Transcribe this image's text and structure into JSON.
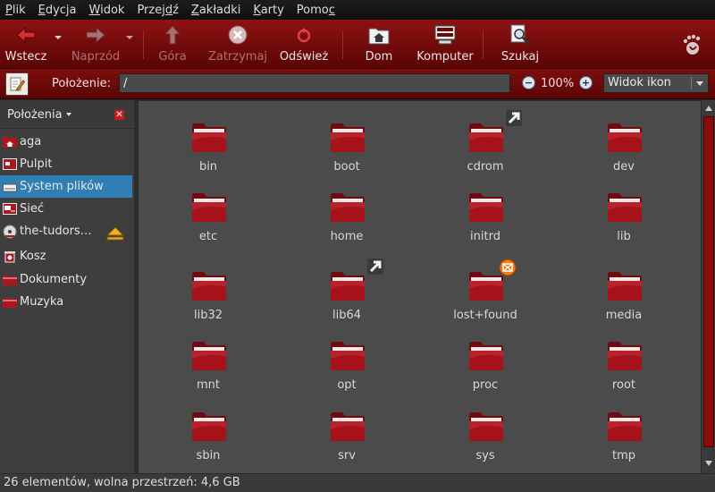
{
  "menubar": {
    "items": [
      {
        "first": "P",
        "rest": "lik"
      },
      {
        "first": "E",
        "rest": "dycja"
      },
      {
        "first": "W",
        "rest": "idok"
      },
      {
        "pre": "Przej",
        "u": "d",
        "post": "ź"
      },
      {
        "first": "Z",
        "rest": "akładki"
      },
      {
        "first": "K",
        "rest": "arty"
      },
      {
        "pre": "Pomo",
        "u": "c",
        "post": ""
      }
    ]
  },
  "toolbar": {
    "back_label": "Wstecz",
    "forward_label": "Naprzód",
    "up_label": "Góra",
    "stop_label": "Zatrzymaj",
    "reload_label": "Odśwież",
    "home_label": "Dom",
    "computer_label": "Komputer",
    "search_label": "Szukaj"
  },
  "location": {
    "label": "Położenie:",
    "value": "/",
    "zoom_level": "100%",
    "view_mode": "Widok ikon"
  },
  "sidebar": {
    "header": "Położenia",
    "items": [
      {
        "label": "aga",
        "icon": "home-folder-icon"
      },
      {
        "label": "Pulpit",
        "icon": "desktop-icon"
      },
      {
        "label": "System plików",
        "icon": "drive-icon"
      },
      {
        "label": "Sieć",
        "icon": "network-icon"
      },
      {
        "label": "the-tudors…",
        "icon": "cdrom-icon"
      },
      {
        "label": "Kosz",
        "icon": "trash-icon"
      },
      {
        "label": "Dokumenty",
        "icon": "folder-icon"
      },
      {
        "label": "Muzyka",
        "icon": "folder-icon"
      }
    ],
    "selected_index": 2
  },
  "files": [
    {
      "name": "bin"
    },
    {
      "name": "boot"
    },
    {
      "name": "cdrom",
      "emblem": "symlink"
    },
    {
      "name": "dev"
    },
    {
      "name": "etc"
    },
    {
      "name": "home"
    },
    {
      "name": "initrd"
    },
    {
      "name": "lib"
    },
    {
      "name": "lib32"
    },
    {
      "name": "lib64",
      "emblem": "symlink"
    },
    {
      "name": "lost+found",
      "emblem": "unreadable"
    },
    {
      "name": "media"
    },
    {
      "name": "mnt"
    },
    {
      "name": "opt"
    },
    {
      "name": "proc"
    },
    {
      "name": "root"
    },
    {
      "name": "sbin"
    },
    {
      "name": "srv"
    },
    {
      "name": "sys"
    },
    {
      "name": "tmp"
    }
  ],
  "status": {
    "text": "26 elementów, wolna przestrzeń: 4,6 GB"
  },
  "colors": {
    "toolbar": "#7a0a0a",
    "selection": "#2f7fb5",
    "folder": "#a5121a"
  }
}
